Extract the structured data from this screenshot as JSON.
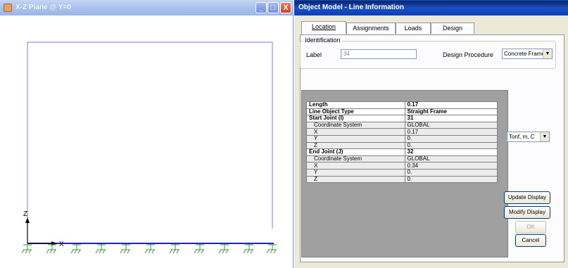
{
  "left_window": {
    "title": "X-Z Plane @ Y=0",
    "window_buttons": [
      "_",
      "□",
      "X"
    ],
    "axes": {
      "z_label": "Z",
      "x_label": "X"
    }
  },
  "dialog": {
    "title": "Object Model - Line Information",
    "tabs": [
      {
        "label": "Location",
        "active": true
      },
      {
        "label": "Assignments",
        "active": false
      },
      {
        "label": "Loads",
        "active": false
      },
      {
        "label": "Design",
        "active": false
      }
    ],
    "identification": {
      "legend": "Identification",
      "label_caption": "Label",
      "label_value": "34",
      "design_procedure_caption": "Design Procedure",
      "design_procedure_value": "Concrete Frame"
    },
    "grid": {
      "rows": [
        {
          "name": "Length",
          "value": "0.17",
          "type": "hdr"
        },
        {
          "name": "Line Object Type",
          "value": "Straight Frame",
          "type": "hdr"
        },
        {
          "name": "Start Joint (I)",
          "value": "31",
          "type": "hdr"
        },
        {
          "name": "Coordinate System",
          "value": "GLOBAL",
          "type": "sub"
        },
        {
          "name": "X",
          "value": "0.17",
          "type": "sub"
        },
        {
          "name": "Y",
          "value": "0.",
          "type": "sub"
        },
        {
          "name": "Z",
          "value": "0.",
          "type": "sub"
        },
        {
          "name": "End Joint (J)",
          "value": "32",
          "type": "hdr"
        },
        {
          "name": "Coordinate System",
          "value": "GLOBAL",
          "type": "sub"
        },
        {
          "name": "X",
          "value": "0.34",
          "type": "sub"
        },
        {
          "name": "Y",
          "value": "0.",
          "type": "sub"
        },
        {
          "name": "Z",
          "value": "0.",
          "type": "sub"
        }
      ]
    },
    "units_value": "Tonf, m, C",
    "buttons": {
      "update_display": "Update Display",
      "modify_display": "Modify Display",
      "ok": "OK",
      "cancel": "Cancel"
    }
  },
  "colors": {
    "frame_line": "#7b7bea",
    "base_line": "#2020c8",
    "support": "#3a9a3a",
    "dialog_title": "#0b3fb8"
  }
}
